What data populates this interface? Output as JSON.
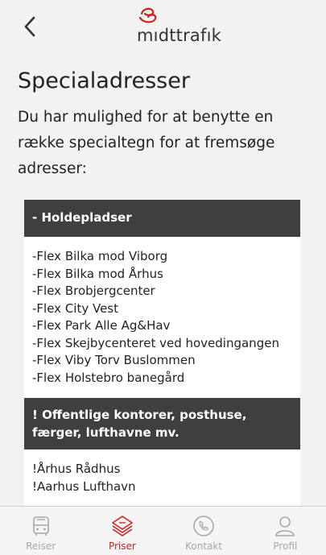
{
  "colors": {
    "brand_red": "#d0201e",
    "header_bar": "#3d3f40",
    "inactive_icon": "#a8a8a8"
  },
  "header": {
    "back_icon": "chevron-left-icon",
    "logo_text": "mıdttrafık"
  },
  "page": {
    "title": "Specialadresser",
    "intro": "Du har mulighed for at benytte en række specialtegn for at fremsøge adresser:"
  },
  "sections": [
    {
      "heading": "- Holdepladser",
      "items": [
        "-Flex Bilka mod Viborg",
        "-Flex Bilka mod Århus",
        "-Flex Brobjergcenter",
        "-Flex City Vest",
        "-Flex Park Alle Ag&Hav",
        "-Flex Skejbycenteret ved hovedingangen",
        "-Flex Viby Torv Buslommen",
        "-Flex Holstebro banegård"
      ]
    },
    {
      "heading": "! Offentlige kontorer, posthuse, færger, lufthavne mv.",
      "items": [
        "!Århus Rådhus",
        "!Aarhus Lufthavn"
      ]
    }
  ],
  "tabbar": {
    "active": "Priser",
    "tabs": [
      {
        "label": "Reiser",
        "icon": "bus-icon"
      },
      {
        "label": "Priser",
        "icon": "tickets-icon"
      },
      {
        "label": "Kontakt",
        "icon": "phone-icon"
      },
      {
        "label": "Profil",
        "icon": "person-icon"
      }
    ]
  }
}
